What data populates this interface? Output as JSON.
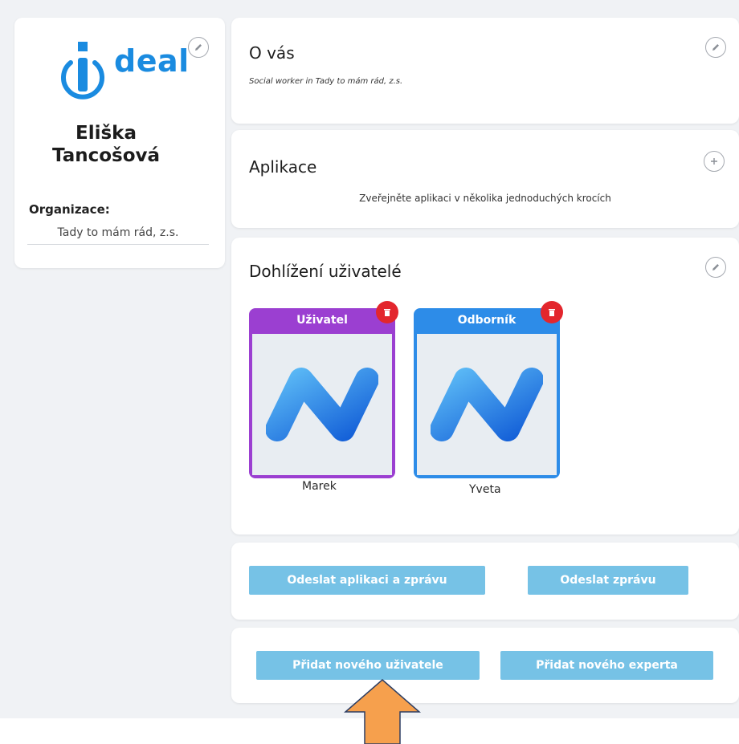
{
  "profile": {
    "logo_text": "deal",
    "name_line1": "Eliška",
    "name_line2": "Tancošová",
    "org_label": "Organizace:",
    "org_value": "Tady to mám rád, z.s.",
    "edit_icon": "pencil-icon"
  },
  "about": {
    "title": "O vás",
    "text": "Social worker in Tady to mám rád, z.s."
  },
  "applications": {
    "title": "Aplikace",
    "text": "Zveřejněte aplikaci v několika jednoduchých krocích",
    "add_icon": "plus-icon"
  },
  "supervised": {
    "title": "Dohlížení uživatelé",
    "users": [
      {
        "role": "Uživatel",
        "name": "Marek",
        "color": "#9b3fd1"
      },
      {
        "role": "Odborník",
        "name": "Yveta",
        "color": "#2d8ce8"
      }
    ],
    "delete_icon": "trash-icon"
  },
  "send_actions": {
    "send_app_message": "Odeslat aplikaci a zprávu",
    "send_message": "Odeslat zprávu"
  },
  "add_actions": {
    "add_user": "Přidat nového uživatele",
    "add_expert": "Přidat nového experta"
  },
  "colors": {
    "accent": "#1a8be0",
    "button": "#76c2e6",
    "delete": "#e3262d",
    "arrow": "#f6a04d"
  }
}
